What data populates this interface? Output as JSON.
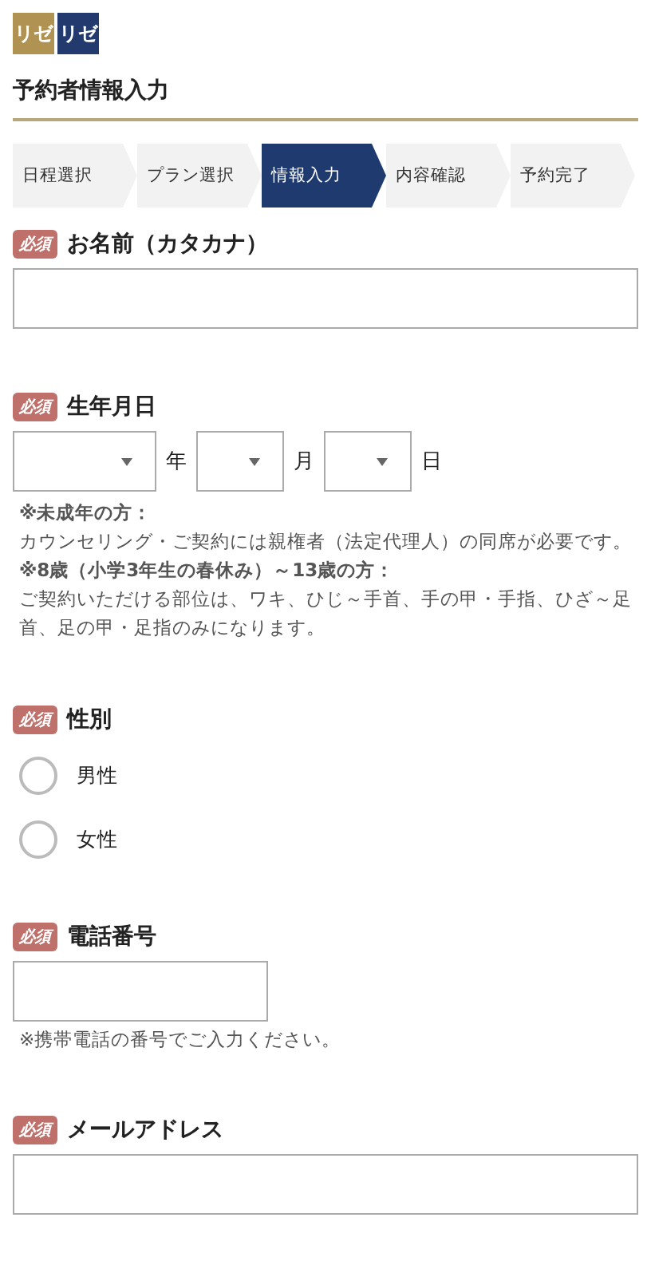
{
  "logo": [
    "リゼ",
    "リゼ"
  ],
  "title": "予約者情報入力",
  "steps": [
    {
      "label": "日程選択",
      "selected": false
    },
    {
      "label": "プラン選択",
      "selected": false
    },
    {
      "label": "情報入力",
      "selected": true
    },
    {
      "label": "内容確認",
      "selected": false
    },
    {
      "label": "予約完了",
      "selected": false
    }
  ],
  "fields": [
    {
      "kind": "text",
      "badge": "必須",
      "label": "お名前（カタカナ）",
      "wide": true
    },
    {
      "kind": "date",
      "badge": "必須",
      "label": "生年月日",
      "units": [
        "年",
        "月",
        "日"
      ],
      "notes": [
        {
          "text": "※未成年の方：",
          "kind": "heading"
        },
        {
          "text": "カウンセリング・ご契約には親権者（法定代理人）の同席が必要です。",
          "kind": "body"
        },
        {
          "text": "※8歳（小学3年生の春休み）～13歳の方：",
          "kind": "heading"
        },
        {
          "text": "ご契約いただける部位は、ワキ、ひじ～手首、手の甲・手指、ひざ～足首、足の甲・足指のみになります。",
          "kind": "body"
        }
      ]
    },
    {
      "kind": "radio",
      "badge": "必須",
      "label": "性別",
      "options": [
        {
          "label": "男性",
          "selected": false
        },
        {
          "label": "女性",
          "selected": false
        }
      ]
    },
    {
      "kind": "text",
      "badge": "必須",
      "label": "電話番号",
      "wide": false,
      "hint": "※携帯電話の番号でご入力ください。"
    },
    {
      "kind": "text",
      "badge": "必須",
      "label": "メールアドレス",
      "wide": true
    }
  ]
}
